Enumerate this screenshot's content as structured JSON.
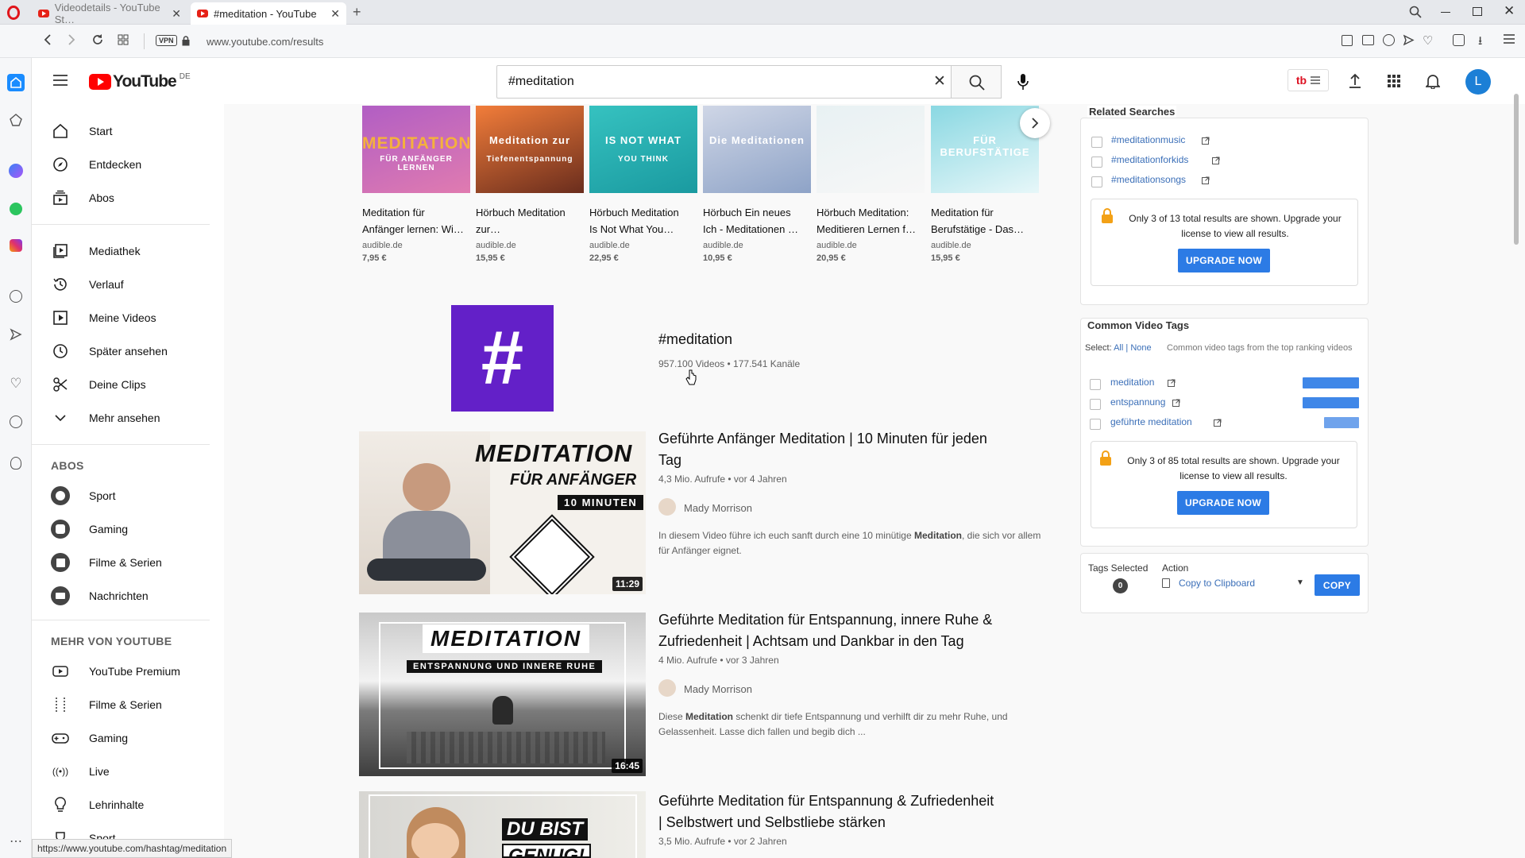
{
  "browser": {
    "tabs": [
      {
        "label": "Videodetails - YouTube St…",
        "active": false
      },
      {
        "label": "#meditation - YouTube",
        "active": true
      }
    ],
    "url": "www.youtube.com/results",
    "vpn_label": "VPN",
    "status_url": "https://www.youtube.com/hashtag/meditation"
  },
  "header": {
    "logo": "YouTube",
    "country": "DE",
    "search_value": "#meditation",
    "avatar_letter": "L"
  },
  "guide": {
    "main": [
      {
        "label": "Start",
        "icon": "home-icon"
      },
      {
        "label": "Entdecken",
        "icon": "compass-icon"
      },
      {
        "label": "Abos",
        "icon": "subscriptions-icon"
      }
    ],
    "library": [
      {
        "label": "Mediathek",
        "icon": "library-icon"
      },
      {
        "label": "Verlauf",
        "icon": "history-icon"
      },
      {
        "label": "Meine Videos",
        "icon": "my-videos-icon"
      },
      {
        "label": "Später ansehen",
        "icon": "watch-later-icon"
      },
      {
        "label": "Deine Clips",
        "icon": "scissors-icon"
      },
      {
        "label": "Mehr ansehen",
        "icon": "chevron-down-icon"
      }
    ],
    "abos_heading": "ABOS",
    "abos": [
      {
        "label": "Sport"
      },
      {
        "label": "Gaming"
      },
      {
        "label": "Filme & Serien"
      },
      {
        "label": "Nachrichten"
      }
    ],
    "more_heading": "MEHR VON YOUTUBE",
    "more": [
      {
        "label": "YouTube Premium",
        "icon": "youtube-icon"
      },
      {
        "label": "Filme & Serien",
        "icon": "film-icon"
      },
      {
        "label": "Gaming",
        "icon": "gamepad-icon"
      },
      {
        "label": "Live",
        "icon": "live-icon"
      },
      {
        "label": "Lehrinhalte",
        "icon": "bulb-icon"
      },
      {
        "label": "Sport",
        "icon": "trophy-icon"
      }
    ]
  },
  "shelf": [
    {
      "title1": "Meditation für",
      "title2": "Anfänger lernen: Wi…",
      "seller": "audible.de",
      "price": "7,95 €",
      "img_text": "MEDITATION",
      "img_sub": "FÜR ANFÄNGER LERNEN",
      "color1": "#b15ec4",
      "color2": "#e07bb0"
    },
    {
      "title1": "Hörbuch Meditation",
      "title2": "zur…",
      "seller": "audible.de",
      "price": "15,95 €",
      "img_text": "Meditation zur",
      "img_sub": "Tiefenentspannung",
      "color1": "#f27d3a",
      "color2": "#6a2d1d"
    },
    {
      "title1": "Hörbuch Meditation",
      "title2": "Is Not What You…",
      "seller": "audible.de",
      "price": "22,95 €",
      "img_text": "IS NOT WHAT",
      "img_sub": "YOU THINK",
      "color1": "#36c2c0",
      "color2": "#1a9aa0"
    },
    {
      "title1": "Hörbuch Ein neues",
      "title2": "Ich - Meditationen …",
      "seller": "audible.de",
      "price": "10,95 €",
      "img_text": "Die Meditationen",
      "img_sub": "",
      "color1": "#cfd6e6",
      "color2": "#8ea3c7"
    },
    {
      "title1": "Hörbuch Meditation:",
      "title2": "Meditieren Lernen f…",
      "seller": "audible.de",
      "price": "20,95 €",
      "img_text": "",
      "img_sub": "",
      "color1": "#e8f1f3",
      "color2": "#f7f7f7"
    },
    {
      "title1": "Meditation für",
      "title2": "Berufstätige - Das…",
      "seller": "audible.de",
      "price": "15,95 €",
      "img_text": "FÜR BERUFSTÄTIGE",
      "img_sub": "",
      "color1": "#8ad8e2",
      "color2": "#e7f7f9"
    }
  ],
  "hashtag": {
    "title": "#meditation",
    "stats": "957.100 Videos • 177.541 Kanäle",
    "symbol": "#"
  },
  "videos": [
    {
      "title1": "Geführte Anfänger Meditation | 10 Minuten für jeden",
      "title2": "Tag",
      "meta": "4,3 Mio. Aufrufe • vor 4 Jahren",
      "channel": "Mady Morrison",
      "desc1_pre": "In diesem Video führe ich euch sanft durch eine 10 minütige ",
      "desc1_bold": "Meditation",
      "desc1_post": ", die sich vor allem",
      "desc2": "für Anfänger eignet.",
      "duration": "11:29",
      "thumb_title": "MEDITATION",
      "thumb_sub": "FÜR ANFÄNGER",
      "thumb_sub2": "10 MINUTEN"
    },
    {
      "title1": "Geführte Meditation für Entspannung, innere Ruhe &",
      "title2": "Zufriedenheit | Achtsam und Dankbar in den Tag",
      "meta": "4 Mio. Aufrufe • vor 3 Jahren",
      "channel": "Mady Morrison",
      "desc1_pre": "Diese ",
      "desc1_bold": "Meditation",
      "desc1_post": " schenkt dir tiefe Entspannung und verhilft dir zu mehr Ruhe, und",
      "desc2": "Gelassenheit. Lasse dich fallen und begib dich ...",
      "duration": "16:45",
      "thumb_title": "MEDITATION",
      "thumb_sub": "ENTSPANNUNG UND INNERE RUHE"
    },
    {
      "title1": "Geführte Meditation für Entspannung & Zufriedenheit",
      "title2": "| Selbstwert und Selbstliebe stärken",
      "meta": "3,5 Mio. Aufrufe • vor 2 Jahren",
      "thumb_title": "DU BIST",
      "thumb_sub": "GENUG!"
    }
  ],
  "related": {
    "heading": "Related Searches",
    "items": [
      "#meditationmusic",
      "#meditationforkids",
      "#meditationsongs"
    ],
    "upgrade_line1": "Only 3 of 13 total results are shown. Upgrade your",
    "upgrade_line2": "license to view all results.",
    "upgrade_btn": "UPGRADE NOW"
  },
  "tags": {
    "heading": "Common Video Tags",
    "select_label": "Select:",
    "select_all": "All",
    "select_sep": "|",
    "select_none": "None",
    "hint": "Common video tags from the top ranking videos",
    "items": [
      {
        "label": "meditation",
        "score": 1.0
      },
      {
        "label": "entspannung",
        "score": 1.0
      },
      {
        "label": "geführte meditation",
        "score": 0.62
      }
    ],
    "upgrade_line1": "Only 3 of 85 total results are shown. Upgrade your",
    "upgrade_line2": "license to view all results.",
    "upgrade_btn": "UPGRADE NOW"
  },
  "action": {
    "tags_selected_label": "Tags Selected",
    "tags_selected_count": "0",
    "action_label": "Action",
    "action_value": "Copy to Clipboard",
    "copy_btn": "COPY"
  }
}
